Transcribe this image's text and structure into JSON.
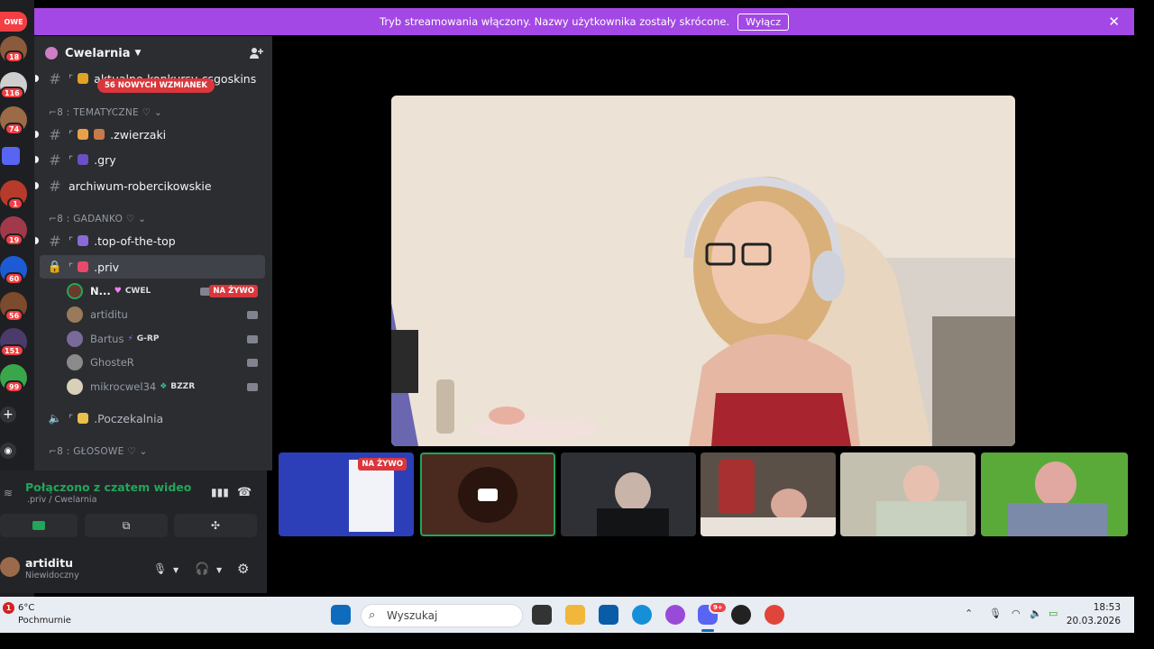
{
  "banner": {
    "text": "Tryb streamowania włączony. Nazwy użytkownika zostały skrócone.",
    "button": "Wyłącz"
  },
  "rail": {
    "tag": "OWE",
    "badges": [
      "18",
      "116",
      "74",
      "1",
      "19",
      "60",
      "56",
      "151",
      "99"
    ]
  },
  "guild": {
    "name": "Cwelarnia"
  },
  "mentions": "56 NOWYCH WZMIANEK",
  "channels": {
    "c0": "aktualne-konkursy-csgoskins",
    "cat1": "TEMATYCZNE",
    "c1": ".zwierzaki",
    "c2": ".gry",
    "c3": "archiwum-robercikowskie",
    "cat2": "GADANKO",
    "c4": ".top-of-the-top",
    "c5": ".priv",
    "c6": ".Poczekalnia",
    "cat3": "GŁOSOWE"
  },
  "voice_users": [
    {
      "name": "N...",
      "tag": "CWEL",
      "live": "NA ŻYWO"
    },
    {
      "name": "artiditu",
      "tag": ""
    },
    {
      "name": "Bartus",
      "tag": "G-RP"
    },
    {
      "name": "GhosteR",
      "tag": ""
    },
    {
      "name": "mikrocwel34",
      "tag": "BZZR"
    }
  ],
  "voice_panel": {
    "status": "Połączono z czatem wideo",
    "location": ".priv / Cwelarnia"
  },
  "user": {
    "name": "artiditu",
    "status": "Niewidoczny"
  },
  "thumbs": {
    "live": "NA ŻYWO"
  },
  "taskbar": {
    "weather_badge": "1",
    "temp": "6°C",
    "condition": "Pochmurnie",
    "search": "Wyszukaj",
    "discord_badge": "9+",
    "time": "18:53",
    "date": "20.03.2026"
  },
  "colors": {
    "banner": "#a348e5",
    "live": "#da373c",
    "connected": "#23a55a",
    "rail": "#1e1f22",
    "sidebar": "#2b2d31"
  }
}
